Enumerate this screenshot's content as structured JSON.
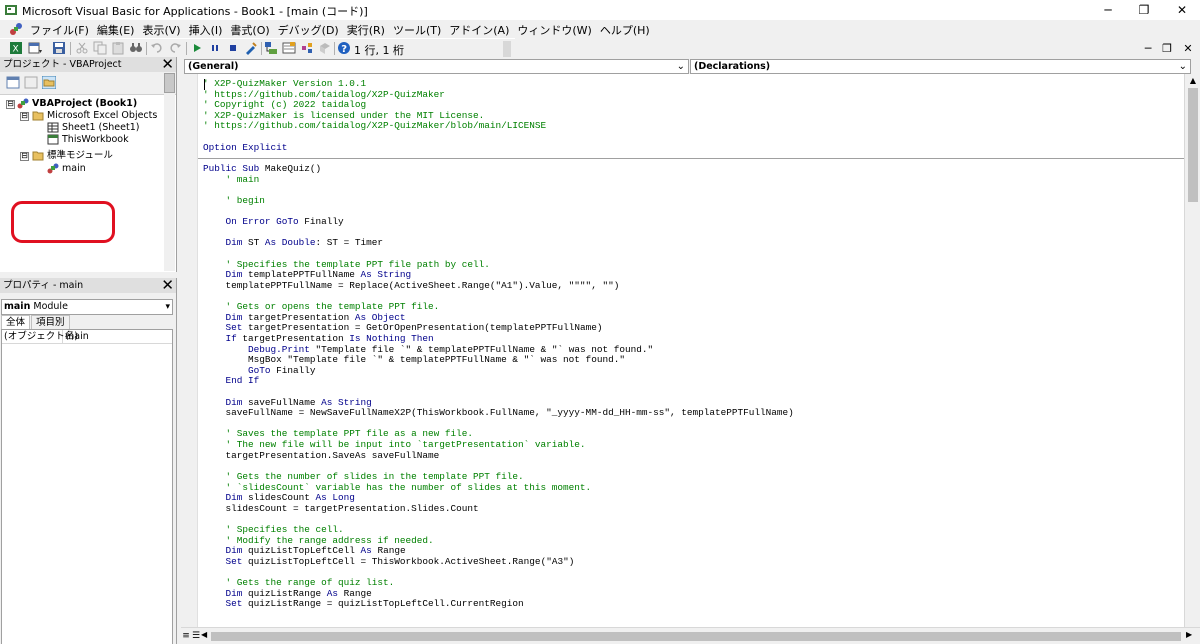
{
  "window": {
    "title": "Microsoft Visual Basic for Applications - Book1 - [main (コード)]",
    "minimize": "─",
    "maximize": "❐",
    "close": "✕"
  },
  "menu": {
    "items": [
      "ファイル(F)",
      "編集(E)",
      "表示(V)",
      "挿入(I)",
      "書式(O)",
      "デバッグ(D)",
      "実行(R)",
      "ツール(T)",
      "アドイン(A)",
      "ウィンドウ(W)",
      "ヘルプ(H)"
    ],
    "mdi_min": "─",
    "mdi_restore": "❐",
    "mdi_close": "✕"
  },
  "toolbar": {
    "cursor_position": "1 行, 1 桁"
  },
  "project_panel": {
    "title": "プロジェクト - VBAProject",
    "close": "✕",
    "tree": {
      "root": "VBAProject (Book1)",
      "folder_excel": "Microsoft Excel Objects",
      "sheet1": "Sheet1 (Sheet1)",
      "thisworkbook": "ThisWorkbook",
      "folder_modules": "標準モジュール",
      "module_main": "main",
      "expanded_glyph": "⊟"
    }
  },
  "properties_panel": {
    "title": "プロパティ - main",
    "close": "✕",
    "object_name": "main",
    "object_type": "Module",
    "tab_all": "全体",
    "tab_category": "項目別",
    "prop_name": "(オブジェクト名)",
    "prop_value": "main",
    "dropdown_arrow": "▾"
  },
  "code_window": {
    "object_combo": "(General)",
    "procedure_combo": "(Declarations)",
    "combo_arrow": "⌄",
    "lines": [
      [
        [
          "c",
          "' X2P-QuizMaker Version 1.0.1"
        ]
      ],
      [
        [
          "c",
          "' https://github.com/taidalog/X2P-QuizMaker"
        ]
      ],
      [
        [
          "c",
          "' Copyright (c) 2022 taidalog"
        ]
      ],
      [
        [
          "c",
          "' X2P-QuizMaker is licensed under the MIT License."
        ]
      ],
      [
        [
          "c",
          "' https://github.com/taidalog/X2P-QuizMaker/blob/main/LICENSE"
        ]
      ],
      [
        [
          "t",
          ""
        ]
      ],
      [
        [
          "k",
          "Option Explicit"
        ]
      ],
      [
        [
          "t",
          ""
        ]
      ],
      [
        [
          "k",
          "Public Sub "
        ],
        [
          "t",
          "MakeQuiz()"
        ]
      ],
      [
        [
          "c",
          "    ' main"
        ]
      ],
      [
        [
          "t",
          ""
        ]
      ],
      [
        [
          "c",
          "    ' begin"
        ]
      ],
      [
        [
          "t",
          ""
        ]
      ],
      [
        [
          "k",
          "    On Error GoTo "
        ],
        [
          "t",
          "Finally"
        ]
      ],
      [
        [
          "t",
          ""
        ]
      ],
      [
        [
          "k",
          "    Dim "
        ],
        [
          "t",
          "ST "
        ],
        [
          "k",
          "As Double"
        ],
        [
          "t",
          ": ST = Timer"
        ]
      ],
      [
        [
          "t",
          ""
        ]
      ],
      [
        [
          "c",
          "    ' Specifies the template PPT file path by cell."
        ]
      ],
      [
        [
          "k",
          "    Dim "
        ],
        [
          "t",
          "templatePPTFullName "
        ],
        [
          "k",
          "As String"
        ]
      ],
      [
        [
          "t",
          "    templatePPTFullName = Replace(ActiveSheet.Range(\"A1\").Value, \"\"\"\", \"\")"
        ]
      ],
      [
        [
          "t",
          ""
        ]
      ],
      [
        [
          "c",
          "    ' Gets or opens the template PPT file."
        ]
      ],
      [
        [
          "k",
          "    Dim "
        ],
        [
          "t",
          "targetPresentation "
        ],
        [
          "k",
          "As Object"
        ]
      ],
      [
        [
          "k",
          "    Set "
        ],
        [
          "t",
          "targetPresentation = GetOrOpenPresentation(templatePPTFullName)"
        ]
      ],
      [
        [
          "k",
          "    If "
        ],
        [
          "t",
          "targetPresentation "
        ],
        [
          "k",
          "Is Nothing Then"
        ]
      ],
      [
        [
          "k",
          "        Debug.Print "
        ],
        [
          "t",
          "\"Template file `\" & templatePPTFullName & \"` was not found.\""
        ]
      ],
      [
        [
          "t",
          "        MsgBox \"Template file `\" & templatePPTFullName & \"` was not found.\""
        ]
      ],
      [
        [
          "k",
          "        GoTo "
        ],
        [
          "t",
          "Finally"
        ]
      ],
      [
        [
          "k",
          "    End If"
        ]
      ],
      [
        [
          "t",
          ""
        ]
      ],
      [
        [
          "k",
          "    Dim "
        ],
        [
          "t",
          "saveFullName "
        ],
        [
          "k",
          "As String"
        ]
      ],
      [
        [
          "t",
          "    saveFullName = NewSaveFullNameX2P(ThisWorkbook.FullName, \"_yyyy-MM-dd_HH-mm-ss\", templatePPTFullName)"
        ]
      ],
      [
        [
          "t",
          ""
        ]
      ],
      [
        [
          "c",
          "    ' Saves the template PPT file as a new file."
        ]
      ],
      [
        [
          "c",
          "    ' The new file will be input into `targetPresentation` variable."
        ]
      ],
      [
        [
          "t",
          "    targetPresentation.SaveAs saveFullName"
        ]
      ],
      [
        [
          "t",
          ""
        ]
      ],
      [
        [
          "c",
          "    ' Gets the number of slides in the template PPT file."
        ]
      ],
      [
        [
          "c",
          "    ' `slidesCount` variable has the number of slides at this moment."
        ]
      ],
      [
        [
          "k",
          "    Dim "
        ],
        [
          "t",
          "slidesCount "
        ],
        [
          "k",
          "As Long"
        ]
      ],
      [
        [
          "t",
          "    slidesCount = targetPresentation.Slides.Count"
        ]
      ],
      [
        [
          "t",
          ""
        ]
      ],
      [
        [
          "c",
          "    ' Specifies the cell."
        ]
      ],
      [
        [
          "c",
          "    ' Modify the range address if needed."
        ]
      ],
      [
        [
          "k",
          "    Dim "
        ],
        [
          "t",
          "quizListTopLeftCell "
        ],
        [
          "k",
          "As "
        ],
        [
          "t",
          "Range"
        ]
      ],
      [
        [
          "k",
          "    Set "
        ],
        [
          "t",
          "quizListTopLeftCell = ThisWorkbook.ActiveSheet.Range(\"A3\")"
        ]
      ],
      [
        [
          "t",
          ""
        ]
      ],
      [
        [
          "c",
          "    ' Gets the range of quiz list."
        ]
      ],
      [
        [
          "k",
          "    Dim "
        ],
        [
          "t",
          "quizListRange "
        ],
        [
          "k",
          "As "
        ],
        [
          "t",
          "Range"
        ]
      ],
      [
        [
          "k",
          "    Set "
        ],
        [
          "t",
          "quizListRange = quizListTopLeftCell.CurrentRegion"
        ]
      ]
    ]
  }
}
